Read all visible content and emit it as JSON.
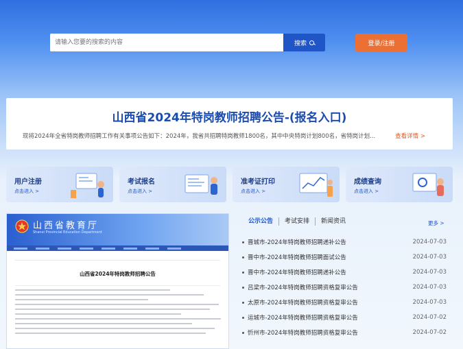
{
  "search": {
    "placeholder": "请输入您要的搜索的内容",
    "button_label": "搜索"
  },
  "header": {
    "login_label": "登录/注册"
  },
  "banner": {
    "title": "山西省2024年特岗教师招聘公告-(报名入口)",
    "text": "现将2024年全省特岗教师招聘工作有关事项公告如下：2024年，我省共招聘特岗教师1800名，其中中央特岗计划800名，省特岗计划...",
    "more_label": "查看详情 >"
  },
  "cards": [
    {
      "title": "用户注册",
      "sub": "点击进入 >"
    },
    {
      "title": "考试报名",
      "sub": "点击进入 >"
    },
    {
      "title": "准考证打印",
      "sub": "点击进入 >"
    },
    {
      "title": "成绩查询",
      "sub": "点击进入 >"
    }
  ],
  "cover": {
    "site_name": "山西省教育厅",
    "site_name_en": "Shanxi Provincial Education Department",
    "doc_title": "山西省2024年特岗教师招聘公告"
  },
  "tabs": [
    {
      "label": "公示公告"
    },
    {
      "label": "考试安排"
    },
    {
      "label": "新闻资讯"
    }
  ],
  "more_label": "更多 >",
  "news": [
    {
      "title": "晋城市-2024年特岗教师招聘递补公告",
      "date": "2024-07-03"
    },
    {
      "title": "晋中市-2024年特岗教师招聘面试公告",
      "date": "2024-07-03"
    },
    {
      "title": "晋中市-2024年特岗教师招聘递补公告",
      "date": "2024-07-03"
    },
    {
      "title": "吕梁市-2024年特岗教师招聘资格复审公告",
      "date": "2024-07-03"
    },
    {
      "title": "太原市-2024年特岗教师招聘资格复审公告",
      "date": "2024-07-03"
    },
    {
      "title": "运城市-2024年特岗教师招聘资格复审公告",
      "date": "2024-07-02"
    },
    {
      "title": "忻州市-2024年特岗教师招聘资格复审公告",
      "date": "2024-07-02"
    }
  ],
  "colors": {
    "primary": "#1f55c7",
    "accent": "#ec6f33",
    "title": "#1a4cb0"
  }
}
